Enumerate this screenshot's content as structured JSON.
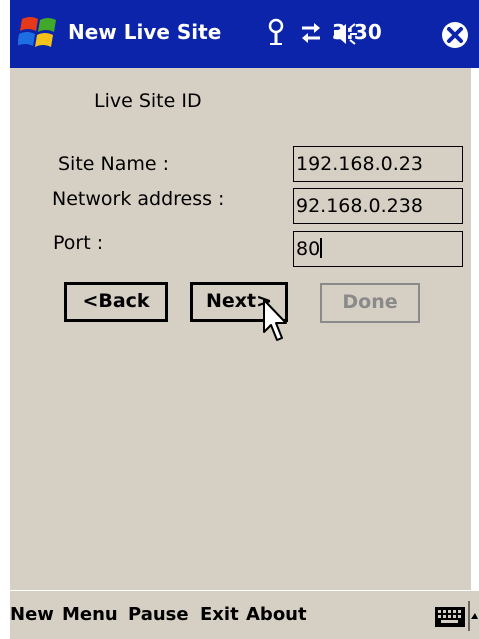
{
  "titlebar": {
    "title": "New Live Site",
    "time": "3:30",
    "icons": [
      "windows-start-icon",
      "antenna-icon",
      "sync-arrows-icon",
      "speaker-icon",
      "close-icon"
    ]
  },
  "form": {
    "heading": "Live Site ID",
    "site_name_label": "Site Name :",
    "site_name_value": "192.168.0.23",
    "network_address_label": "Network address :",
    "network_address_value": "92.168.0.238",
    "port_label": "Port :",
    "port_value": "80"
  },
  "buttons": {
    "back": "<Back",
    "next": "Next>",
    "done": "Done",
    "done_enabled": false
  },
  "menubar": {
    "items": [
      "New",
      "Menu",
      "Pause",
      "Exit",
      "About"
    ],
    "icons": [
      "keyboard-icon",
      "sip-up-arrow-icon"
    ]
  },
  "colors": {
    "titlebar_bg": "#0b24a9",
    "content_bg": "#d6cfc3",
    "disabled_text": "#8a8a8a"
  }
}
